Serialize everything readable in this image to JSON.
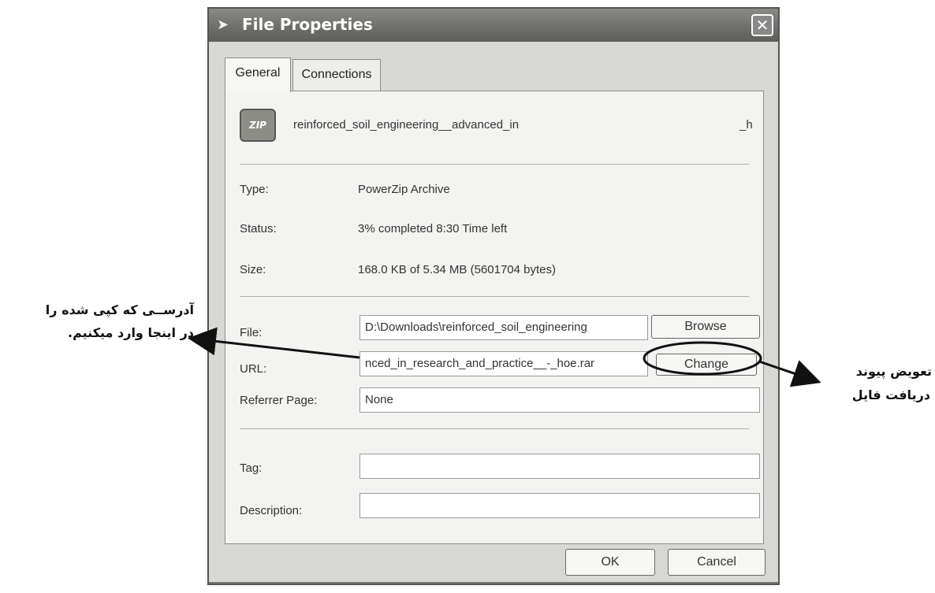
{
  "dialog": {
    "title": "File Properties",
    "close_icon": "close-icon",
    "tabs": [
      {
        "label": "General",
        "active": true
      },
      {
        "label": "Connections",
        "active": false
      }
    ],
    "file_icon": "zip-archive-icon",
    "file_icon_text": "ZIP",
    "file_name": "reinforced_soil_engineering__advanced_in",
    "file_name_suffix": "_h",
    "info": {
      "type_label": "Type:",
      "type_value": "PowerZip Archive",
      "status_label": "Status:",
      "status_value": "3% completed 8:30 Time left",
      "size_label": "Size:",
      "size_value": "168.0 KB of 5.34 MB (5601704 bytes)"
    },
    "fields": {
      "file_label": "File:",
      "file_value": "D:\\Downloads\\reinforced_soil_engineering",
      "url_label": "URL:",
      "url_value": "nced_in_research_and_practice__-_hoe.rar",
      "referrer_label": "Referrer Page:",
      "referrer_value": "None",
      "tag_label": "Tag:",
      "tag_value": "",
      "description_label": "Description:",
      "description_value": ""
    },
    "buttons": {
      "browse": "Browse",
      "change": "Change",
      "ok": "OK",
      "cancel": "Cancel"
    }
  },
  "annotations": {
    "left_line1": "آدرســی که کپی شده را",
    "left_line2": "در اینجا وارد میکنیم.",
    "right_line1": "تعویض پیوند",
    "right_line2": "دریافت فایل"
  }
}
